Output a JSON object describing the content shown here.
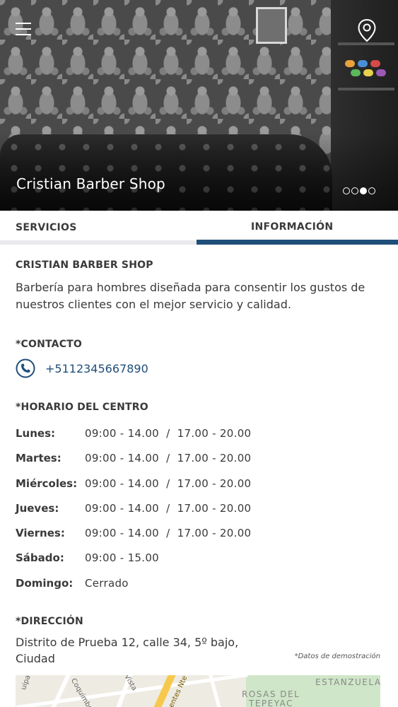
{
  "hero": {
    "title": "Cristian Barber Shop",
    "carousel": {
      "total": 4,
      "active_index": 2
    },
    "menu_icon": "hamburger-menu-icon",
    "location_icon": "map-pin-icon"
  },
  "tabs": [
    {
      "label": "SERVICIOS",
      "selected": false
    },
    {
      "label": "INFORMACIÓN",
      "selected": true
    }
  ],
  "info": {
    "name": "CRISTIAN BARBER SHOP",
    "description": "Barbería para hombres diseñada para consentir los gustos de nuestros clientes con el mejor servicio y calidad.",
    "contact": {
      "heading": "*CONTACTO",
      "phone": "+5112345667890",
      "icon": "phone-icon"
    },
    "schedule": {
      "heading": "*HORARIO DEL CENTRO",
      "rows": [
        {
          "day": "Lunes:",
          "hours": "09:00 - 14.00  /  17.00 - 20.00"
        },
        {
          "day": "Martes:",
          "hours": "09:00 - 14.00  /  17.00 - 20.00"
        },
        {
          "day": "Miércoles:",
          "hours": "09:00 - 14.00  /  17.00 - 20.00"
        },
        {
          "day": "Jueves:",
          "hours": "09:00 - 14.00  /  17.00 - 20.00"
        },
        {
          "day": "Viernes:",
          "hours": "09:00 - 14.00  /  17.00 - 20.00"
        },
        {
          "day": "Sábado:",
          "hours": "09:00 - 15.00"
        },
        {
          "day": "Domingo:",
          "hours": "Cerrado"
        }
      ]
    },
    "address": {
      "heading": "*DIRECCIÓN",
      "text": "Distrito de Prueba 12, calle 34, 5º bajo, Ciudad",
      "note": "*Datos de demostración"
    },
    "map": {
      "labels": [
        "Coquimbo",
        "ESTANZUELA",
        "ROSAS DEL",
        "TEPEYAC",
        "entes Nte",
        "Vista",
        "uipa"
      ]
    }
  },
  "colors": {
    "accent": "#1f4e79",
    "text": "#3a3a3a",
    "tab_inactive_bar": "#e9e9ee"
  }
}
